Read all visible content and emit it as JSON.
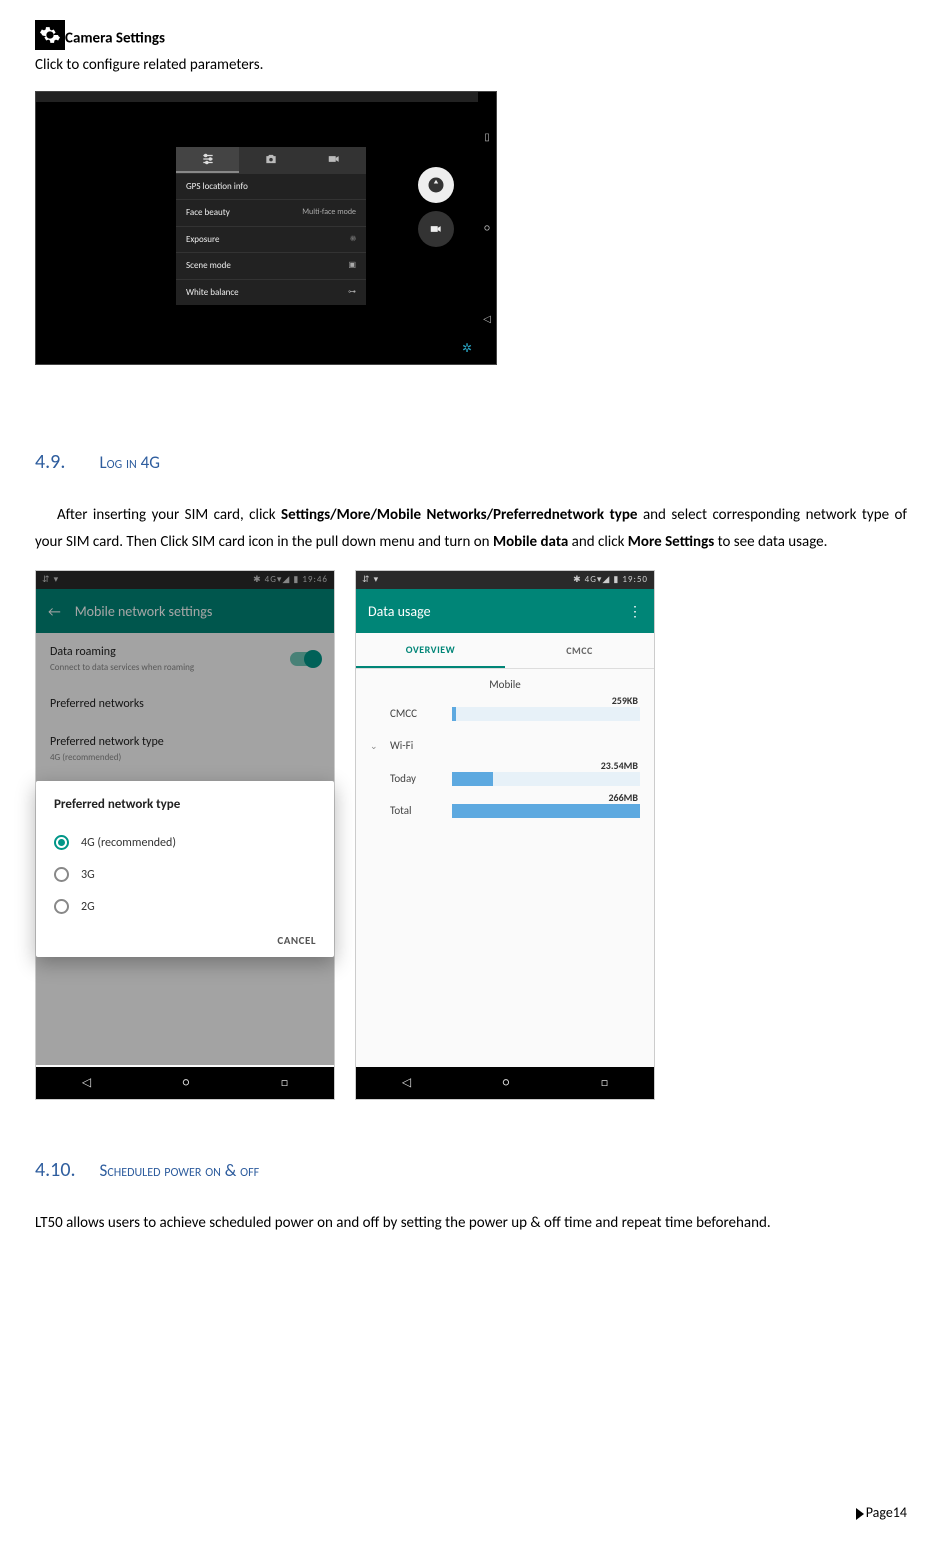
{
  "cameraSettings": {
    "title": "Camera Settings",
    "desc": "Click to configure related parameters.",
    "menu": {
      "rows": [
        {
          "label": "GPS location info",
          "val": ""
        },
        {
          "label": "Face beauty",
          "val": "Multi-face mode"
        },
        {
          "label": "Exposure",
          "val": ""
        },
        {
          "label": "Scene mode",
          "val": ""
        },
        {
          "label": "White balance",
          "val": ""
        }
      ]
    }
  },
  "sec49": {
    "num": "4.9.",
    "title": "Log in 4G",
    "para_pre": "After inserting your SIM card, click ",
    "bold1": "Settings/More/Mobile Networks/Preferrednetwork type",
    "para_mid1": " and select corresponding network type of your SIM card. Then Click SIM card icon in the pull down menu and turn on ",
    "bold2": "Mobile data",
    "para_mid2": " and click ",
    "bold3": "More Settings",
    "para_end": " to see data usage."
  },
  "phone1": {
    "status_left": "⇵ ▾",
    "status_right": "✱ 4G▾◢ ▮ 19:46",
    "header": "Mobile network settings",
    "s1_t": "Data roaming",
    "s1_s": "Connect to data services when roaming",
    "s2_t": "Preferred networks",
    "s3_t": "Preferred network type",
    "s3_s": "4G (recommended)",
    "dialog_title": "Preferred network type",
    "opt1": "4G (recommended)",
    "opt2": "3G",
    "opt3": "2G",
    "cancel": "CANCEL"
  },
  "phone2": {
    "status_left": "⇵ ▾",
    "status_right": "✱ 4G▾◢ ▮ 19:50",
    "header": "Data usage",
    "tab1": "OVERVIEW",
    "tab2": "CMCC",
    "sub": "Mobile",
    "r1_lbl": "CMCC",
    "r1_val": "259KB",
    "r1_fill": "2%",
    "r2_lbl": "Wi-Fi",
    "r3_lbl": "Today",
    "r3_val": "23.54MB",
    "r3_fill": "22%",
    "r4_lbl": "Total",
    "r4_val": "266MB",
    "r4_fill": "100%"
  },
  "sec410": {
    "num": "4.10.",
    "title": "Scheduled power on & off",
    "para": "LT50 allows users to achieve scheduled power on and off by setting the power up & off time and repeat time beforehand."
  },
  "footer": {
    "page": "Page14"
  }
}
